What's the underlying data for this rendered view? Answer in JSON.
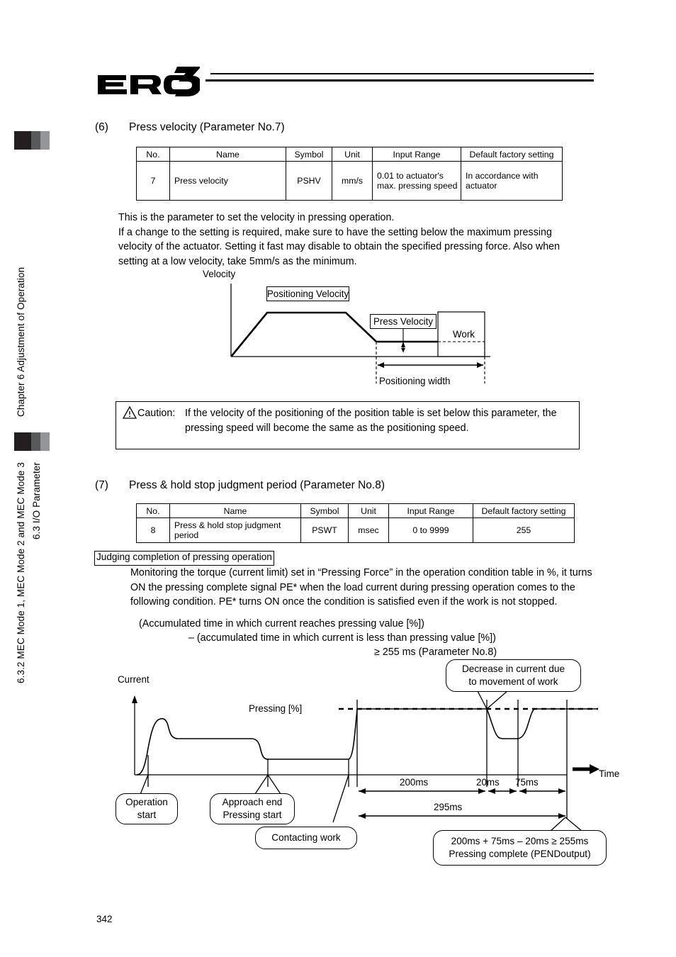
{
  "sidebar": {
    "chapter_label": "Chapter 6 Adjustment of Operation",
    "section_label_1": "6.3 I/O Parameter",
    "section_label_2": "6.3.2 MEC Mode 1, MEC Mode 2 and MEC Mode 3"
  },
  "header": {
    "logo_text": "ERC3"
  },
  "page": {
    "number": "342"
  },
  "section6": {
    "num": "(6)",
    "title": "Press velocity (Parameter No.7)",
    "table": {
      "headers": [
        "No.",
        "Name",
        "Symbol",
        "Unit",
        "Input Range",
        "Default factory setting"
      ],
      "rows": [
        [
          "7",
          "Press velocity",
          "PSHV",
          "mm/s",
          "0.01 to actuator's max. pressing speed",
          "In accordance with actuator"
        ]
      ]
    },
    "body": "This is the parameter to set the velocity in pressing operation.\nIf a change to the setting is required, make sure to have the setting below the maximum pressing velocity of the actuator. Setting it fast may disable to obtain the specified pressing force. Also when setting at a low velocity, take 5mm/s as the minimum.",
    "diagram": {
      "y_axis_label": "Velocity",
      "label_positioning_velocity": "Positioning Velocity",
      "label_press_velocity": "Press Velocity",
      "label_work": "Work",
      "label_positioning_width": "Positioning width"
    },
    "caution": {
      "label": "Caution:",
      "text": "If the velocity of the positioning of the position table is set below this parameter, the pressing speed will become the same as the positioning speed."
    }
  },
  "section7": {
    "num": "(7)",
    "title": "Press & hold stop judgment period (Parameter No.8)",
    "table": {
      "headers": [
        "No.",
        "Name",
        "Symbol",
        "Unit",
        "Input Range",
        "Default factory setting"
      ],
      "rows": [
        [
          "8",
          "Press & hold stop judgment period",
          "PSWT",
          "msec",
          "0 to 9999",
          "255"
        ]
      ]
    },
    "judging_heading": "Judging completion of pressing operation",
    "judging_body": "Monitoring the torque (current limit) set in “Pressing Force” in the operation condition table in %, it turns ON the pressing complete signal PE* when the load current during pressing operation comes to the following condition. PE* turns ON once the condition is satisfied even if the work is not stopped.",
    "formula_line1": "(Accumulated time in which current reaches pressing value [%])",
    "formula_line2": "– (accumulated time in which current is less than pressing value [%])",
    "formula_line3": "≥ 255 ms (Parameter No.8)"
  },
  "chart_data": {
    "type": "line",
    "title": "",
    "xlabel": "Time",
    "ylabel": "Current",
    "threshold_label": "Pressing [%]",
    "annotations": [
      "Decrease in current due to movement of work",
      "Operation start",
      "Approach end Pressing start",
      "Contacting work",
      "200ms + 75ms – 20ms ≥ 255ms Pressing complete (PENDoutput)"
    ],
    "callouts": {
      "decrease": [
        "Decrease in current due",
        "to movement of work"
      ],
      "operation_start": [
        "Operation",
        "start"
      ],
      "approach_end": [
        "Approach end",
        "Pressing start"
      ],
      "contacting_work": [
        "Contacting work"
      ],
      "result": [
        "200ms + 75ms – 20ms ≥ 255ms",
        "Pressing complete (PENDoutput)"
      ]
    },
    "intervals": [
      {
        "label": "200ms",
        "value": 200,
        "unit": "ms"
      },
      {
        "label": "20ms",
        "value": 20,
        "unit": "ms"
      },
      {
        "label": "75ms",
        "value": 75,
        "unit": "ms"
      }
    ],
    "total_interval": {
      "label": "295ms",
      "value": 295,
      "unit": "ms"
    },
    "segments": [
      {
        "name": "acceleration overshoot",
        "level": "high-peak"
      },
      {
        "name": "constant move current",
        "level": "medium"
      },
      {
        "name": "approach current",
        "level": "low"
      },
      {
        "name": "pressing current",
        "level": "threshold"
      },
      {
        "name": "dip from work movement",
        "level": "below-threshold"
      },
      {
        "name": "pressing current restored",
        "level": "threshold"
      }
    ]
  }
}
